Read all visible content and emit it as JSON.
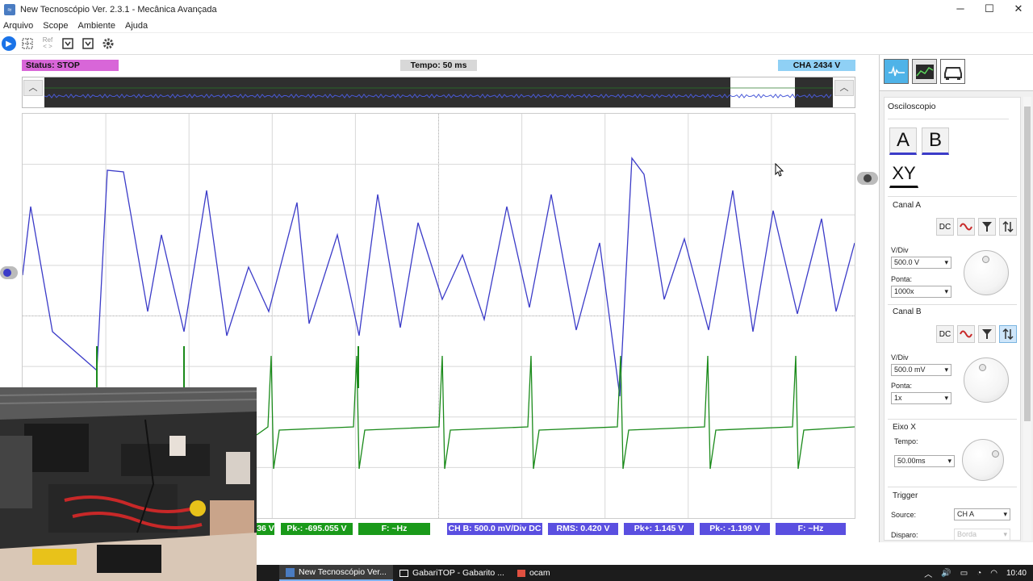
{
  "window": {
    "title": "New Tecnoscópio Ver. 2.3.1 - Mecânica Avançada",
    "minimize": "─",
    "maximize": "☐",
    "close": "✕"
  },
  "menu": [
    "Arquivo",
    "Scope",
    "Ambiente",
    "Ajuda"
  ],
  "toolbar": {
    "ref_label": "Ref"
  },
  "status_bar": {
    "status": "Status: STOP",
    "tempo": "Tempo: 50 ms",
    "cha": "CHA 2434 V"
  },
  "measurements": {
    "cha_partial": "36 V",
    "cha_pk_minus": "Pk-: -695.055 V",
    "cha_freq": "F: ~Hz",
    "chb_div": "CH B: 500.0 mV/Div DC",
    "chb_rms": "RMS: 0.420 V",
    "chb_pk_plus": "Pk+: 1.145 V",
    "chb_pk_minus": "Pk-: -1.199 V",
    "chb_freq": "F: ~Hz"
  },
  "panel": {
    "section": "Osciloscopio",
    "btn_a": "A",
    "btn_b": "B",
    "btn_xy": "XY",
    "canal_a": {
      "title": "Canal A",
      "dc": "DC",
      "vdiv_label": "V/Div",
      "vdiv": "500.0 V",
      "ponta_label": "Ponta:",
      "ponta": "1000x"
    },
    "canal_b": {
      "title": "Canal B",
      "dc": "DC",
      "vdiv_label": "V/Div",
      "vdiv": "500.0 mV",
      "ponta_label": "Ponta:",
      "ponta": "1x"
    },
    "eixo_x": {
      "title": "Eixo X",
      "tempo_label": "Tempo:",
      "tempo": "50.00ms"
    },
    "trigger": {
      "title": "Trigger",
      "source_label": "Source:",
      "source": "CH A",
      "disparo_label": "Disparo:",
      "disparo": "Borda"
    }
  },
  "taskbar": {
    "items": [
      "New Tecnoscópio Ver...",
      "GabariTOP - Gabarito ...",
      "ocam"
    ],
    "clock": "10:40"
  },
  "colors": {
    "channel_a": "#3b3bc8",
    "channel_b": "#1a8a1a",
    "status": "#d866d8",
    "cha_badge": "#8fd0f5",
    "meas_a": "#1a9a1a",
    "meas_b": "#5a4fe0"
  }
}
